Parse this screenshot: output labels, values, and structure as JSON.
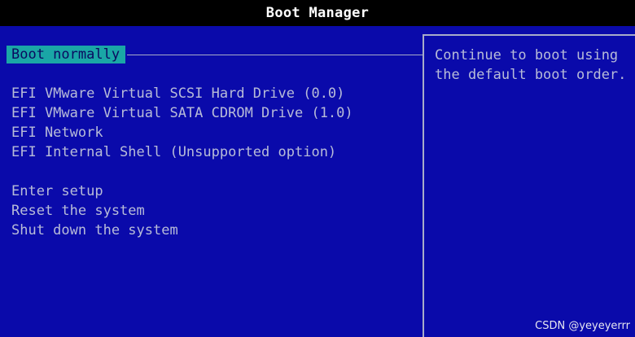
{
  "window": {
    "title": "Boot Manager"
  },
  "menu": {
    "selected": "Boot normally",
    "devices": [
      "EFI VMware Virtual SCSI Hard Drive (0.0)",
      "EFI VMware Virtual SATA CDROM Drive (1.0)",
      "EFI Network",
      "EFI Internal Shell (Unsupported option)"
    ],
    "actions": [
      "Enter setup",
      "Reset the system",
      "Shut down the system"
    ]
  },
  "help": {
    "text": "Continue to boot using\nthe default boot order."
  },
  "watermark": "CSDN @yeyeyerrr",
  "colors": {
    "background": "#0a0aaa",
    "titlebar": "#000000",
    "highlight": "#1aa6a6",
    "text": "#b8bcd8"
  }
}
